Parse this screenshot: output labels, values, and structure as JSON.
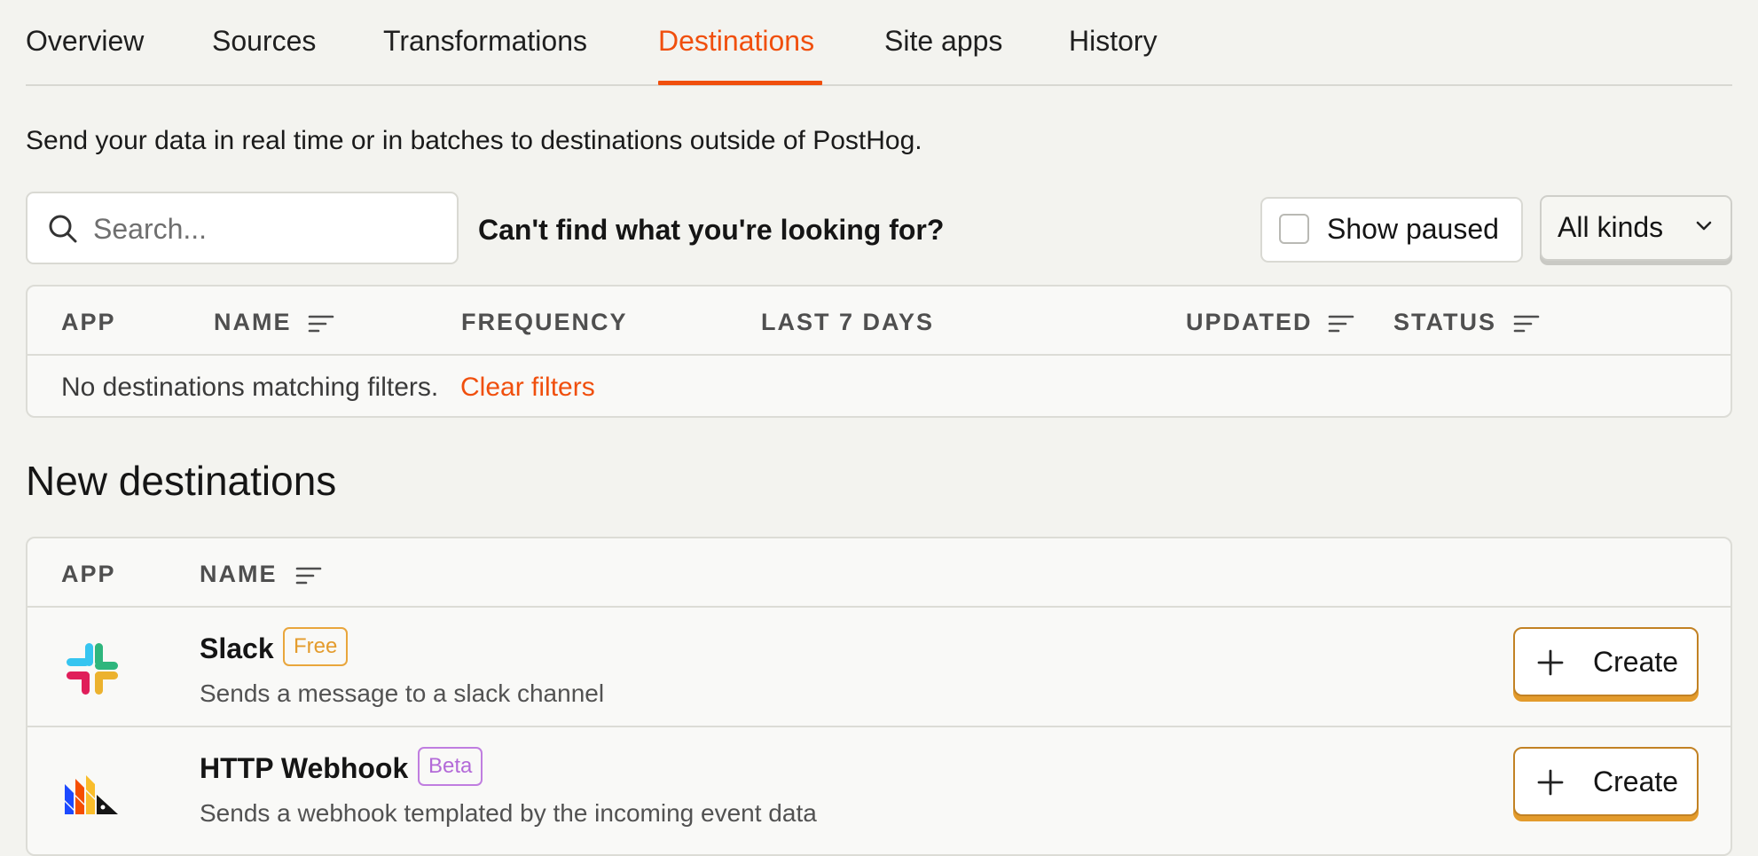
{
  "tabs": [
    {
      "label": "Overview"
    },
    {
      "label": "Sources"
    },
    {
      "label": "Transformations"
    },
    {
      "label": "Destinations",
      "active": true
    },
    {
      "label": "Site apps"
    },
    {
      "label": "History"
    }
  ],
  "intro": "Send your data in real time or in batches to destinations outside of PostHog.",
  "filters": {
    "search_placeholder": "Search...",
    "search_value": "",
    "cant_find": "Can't find what you're looking for?",
    "show_paused_label": "Show paused",
    "show_paused_checked": false,
    "kind_select": "All kinds"
  },
  "destinations_table": {
    "columns": [
      "APP",
      "NAME",
      "FREQUENCY",
      "LAST 7 DAYS",
      "UPDATED",
      "STATUS"
    ],
    "sortable_columns": [
      "NAME",
      "UPDATED",
      "STATUS"
    ],
    "empty_text": "No destinations matching filters.",
    "clear_filters": "Clear filters"
  },
  "new_destinations": {
    "title": "New destinations",
    "columns": [
      "APP",
      "NAME"
    ],
    "rows": [
      {
        "name": "Slack",
        "badge": "Free",
        "description": "Sends a message to a slack channel",
        "icon": "slack-logo-icon",
        "action": "Create"
      },
      {
        "name": "HTTP Webhook",
        "badge": "Beta",
        "description": "Sends a webhook templated by the incoming event data",
        "icon": "posthog-logo-icon",
        "action": "Create"
      }
    ]
  },
  "colors": {
    "accent": "#f04f0d",
    "free_badge": "#e49c2d",
    "beta_badge": "#b36ad8",
    "create_shadow": "#e39b2c",
    "background": "#f3f3ef"
  }
}
